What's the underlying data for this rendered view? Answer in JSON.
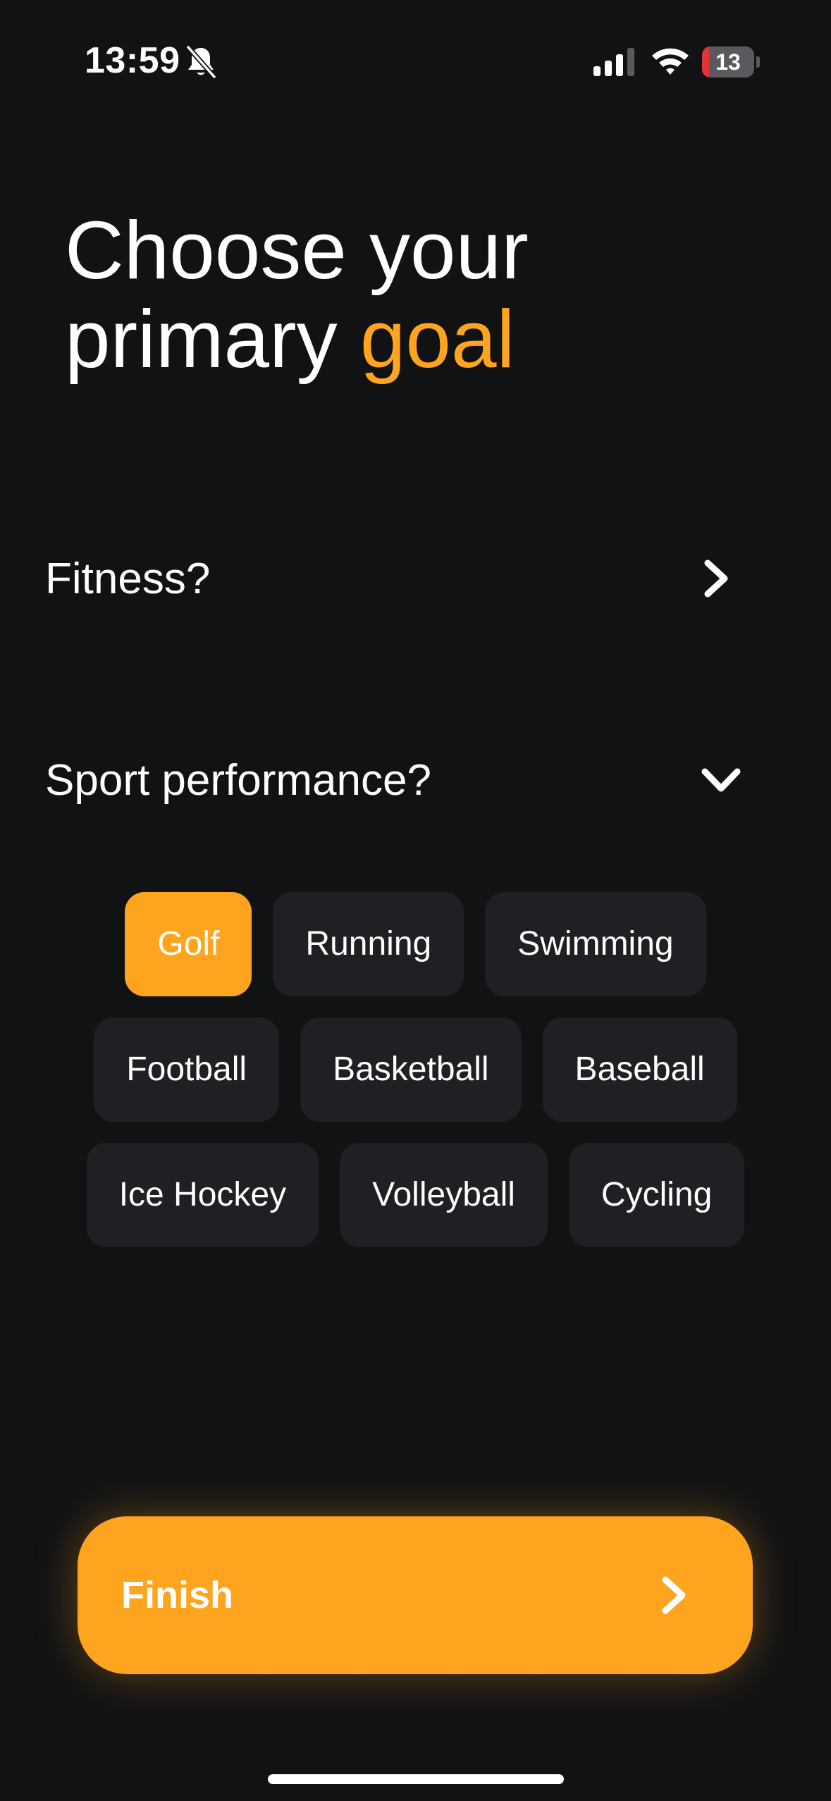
{
  "status_bar": {
    "time": "13:59",
    "battery_level": "13",
    "icons": [
      "bell-slash-icon",
      "cellular-signal-icon",
      "wifi-icon",
      "battery-icon"
    ]
  },
  "heading": {
    "line1": "Choose your",
    "line2_plain": "primary ",
    "line2_accent": "goal"
  },
  "goals": {
    "fitness": {
      "label": "Fitness?",
      "icon": "chevron-right-icon",
      "expanded": false
    },
    "sport": {
      "label": "Sport performance?",
      "icon": "chevron-down-icon",
      "expanded": true
    }
  },
  "sports": {
    "selected": "Golf",
    "rows": [
      [
        "Golf",
        "Running",
        "Swimming"
      ],
      [
        "Football",
        "Basketball",
        "Baseball"
      ],
      [
        "Ice Hockey",
        "Volleyball",
        "Cycling"
      ]
    ]
  },
  "finish": {
    "label": "Finish",
    "icon": "chevron-right-icon"
  },
  "colors": {
    "background": "#111214",
    "accent": "#ffa41e",
    "chip": "#1f2023",
    "battery_low": "#e5333a"
  }
}
